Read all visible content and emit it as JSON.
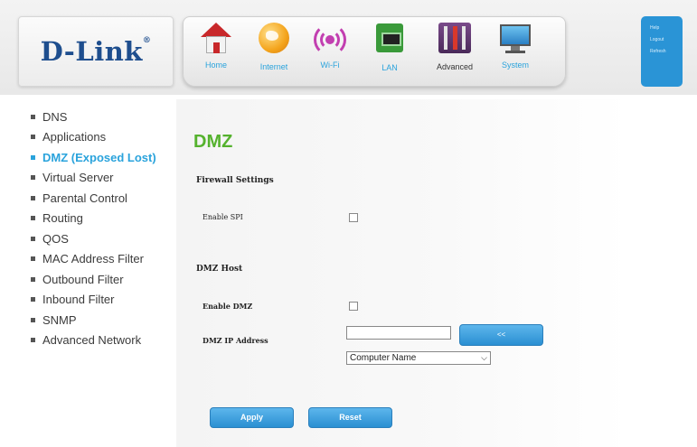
{
  "brand": {
    "logo_text": "D-Link"
  },
  "nav": {
    "home": "Home",
    "internet": "Internet",
    "wifi": "Wi-Fi",
    "lan": "LAN",
    "advanced": "Advanced",
    "system": "System"
  },
  "util_links": [
    "Help",
    "Logout",
    "Refresh"
  ],
  "sidebar": {
    "items": [
      {
        "label": "DNS"
      },
      {
        "label": "Applications"
      },
      {
        "label": "DMZ (Exposed Lost)"
      },
      {
        "label": "Virtual Server"
      },
      {
        "label": "Parental Control"
      },
      {
        "label": "Routing"
      },
      {
        "label": "QOS"
      },
      {
        "label": "MAC Address Filter"
      },
      {
        "label": "Outbound Filter"
      },
      {
        "label": "Inbound Filter"
      },
      {
        "label": "SNMP"
      },
      {
        "label": "Advanced Network"
      }
    ],
    "active_index": 2
  },
  "page": {
    "title": "DMZ",
    "firewall_section": "Firewall Settings",
    "enable_spi_label": "Enable SPI",
    "enable_spi_checked": false,
    "dmz_section": "DMZ Host",
    "enable_dmz_label": "Enable DMZ",
    "enable_dmz_checked": false,
    "dmz_ip_label": "DMZ IP Address",
    "dmz_ip_value": "",
    "copy_button_label": "<<",
    "computer_select_value": "Computer Name",
    "apply_label": "Apply",
    "reset_label": "Reset"
  },
  "colors": {
    "accent_blue": "#2aa3dc",
    "title_green": "#55b22e",
    "logo_blue": "#1e4e8e"
  }
}
